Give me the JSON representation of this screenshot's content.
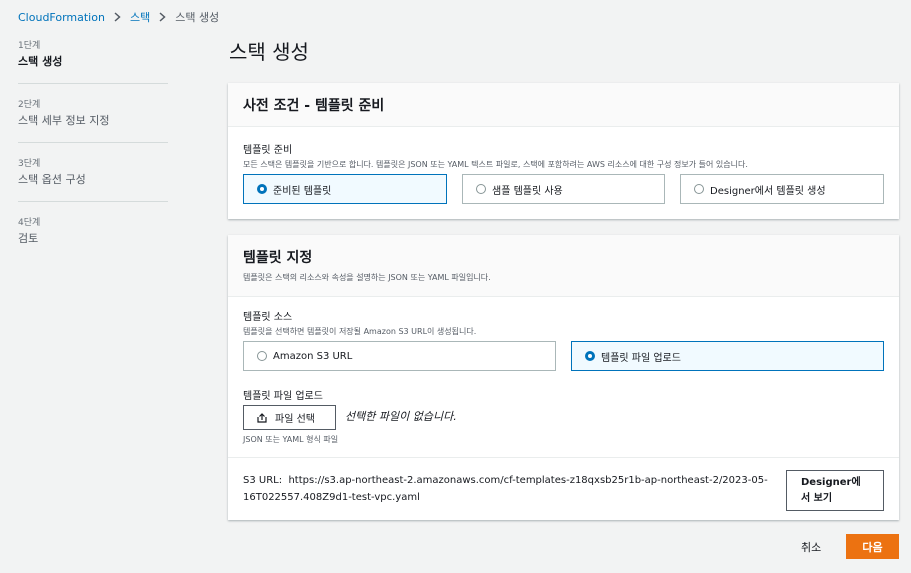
{
  "breadcrumb": {
    "items": [
      "CloudFormation",
      "스택"
    ],
    "current": "스택 생성"
  },
  "steps": [
    {
      "num": "1단계",
      "label": "스택 생성"
    },
    {
      "num": "2단계",
      "label": "스택 세부 정보 지정"
    },
    {
      "num": "3단계",
      "label": "스택 옵션 구성"
    },
    {
      "num": "4단계",
      "label": "검토"
    }
  ],
  "page_title": "스택 생성",
  "prereq": {
    "title": "사전 조건 - 템플릿 준비",
    "field_label": "템플릿 준비",
    "field_desc": "모든 스택은 템플릿을 기반으로 합니다. 템플릿은 JSON 또는 YAML 텍스트 파일로, 스택에 포함하려는 AWS 리소스에 대한 구성 정보가 들어 있습니다.",
    "options": [
      "준비된 템플릿",
      "샘플 템플릿 사용",
      "Designer에서 템플릿 생성"
    ],
    "selected_index": 0
  },
  "template": {
    "title": "템플릿 지정",
    "desc": "템플릿은 스택의 리소스와 속성을 설명하는 JSON 또는 YAML 파일입니다.",
    "source_label": "템플릿 소스",
    "source_desc": "템플릿을 선택하면 템플릿이 저장될 Amazon S3 URL이 생성됩니다.",
    "source_options": [
      "Amazon S3 URL",
      "템플릿 파일 업로드"
    ],
    "source_selected_index": 1,
    "upload_label": "템플릿 파일 업로드",
    "choose_file_label": "파일 선택",
    "no_file_text": "선택한 파일이 없습니다.",
    "upload_hint": "JSON 또는 YAML 형식 파일",
    "s3_url_label": "S3 URL:",
    "s3_url_value": "https://s3.ap-northeast-2.amazonaws.com/cf-templates-z18qxsb25r1b-ap-northeast-2/2023-05-16T022557.408Z9d1-test-vpc.yaml",
    "designer_button": "Designer에서 보기"
  },
  "footer": {
    "cancel": "취소",
    "next": "다음"
  },
  "colors": {
    "link": "#0073bb",
    "primary": "#ec7211",
    "selected_border": "#0073bb"
  }
}
